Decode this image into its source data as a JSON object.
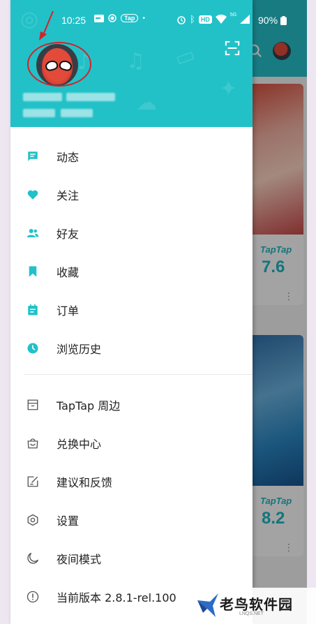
{
  "status_bar": {
    "time": "10:25",
    "tap_badge": "Tap",
    "hd_badge": "HD",
    "network": "5G",
    "battery": "90%"
  },
  "background": {
    "cards": [
      {
        "brand": "TapTap",
        "score": "7.6"
      },
      {
        "brand": "TapTap",
        "score": "8.2"
      }
    ]
  },
  "drawer": {
    "menu_primary": [
      {
        "label": "动态",
        "icon": "message-icon"
      },
      {
        "label": "关注",
        "icon": "heart-icon"
      },
      {
        "label": "好友",
        "icon": "friends-icon"
      },
      {
        "label": "收藏",
        "icon": "bookmark-icon"
      },
      {
        "label": "订单",
        "icon": "order-icon"
      },
      {
        "label": "浏览历史",
        "icon": "clock-icon"
      }
    ],
    "menu_secondary": [
      {
        "label": "TapTap 周边",
        "icon": "store-icon"
      },
      {
        "label": "兑换中心",
        "icon": "bag-icon"
      },
      {
        "label": "建议和反馈",
        "icon": "feedback-icon"
      },
      {
        "label": "设置",
        "icon": "settings-icon"
      },
      {
        "label": "夜间模式",
        "icon": "moon-icon"
      },
      {
        "label": "当前版本 2.8.1-rel.100",
        "icon": "info-icon"
      }
    ]
  },
  "watermark": {
    "text": "老鸟软件园",
    "sub": "LNQS.NET"
  },
  "colors": {
    "accent": "#22c1c8",
    "annotation": "#d3232a"
  }
}
